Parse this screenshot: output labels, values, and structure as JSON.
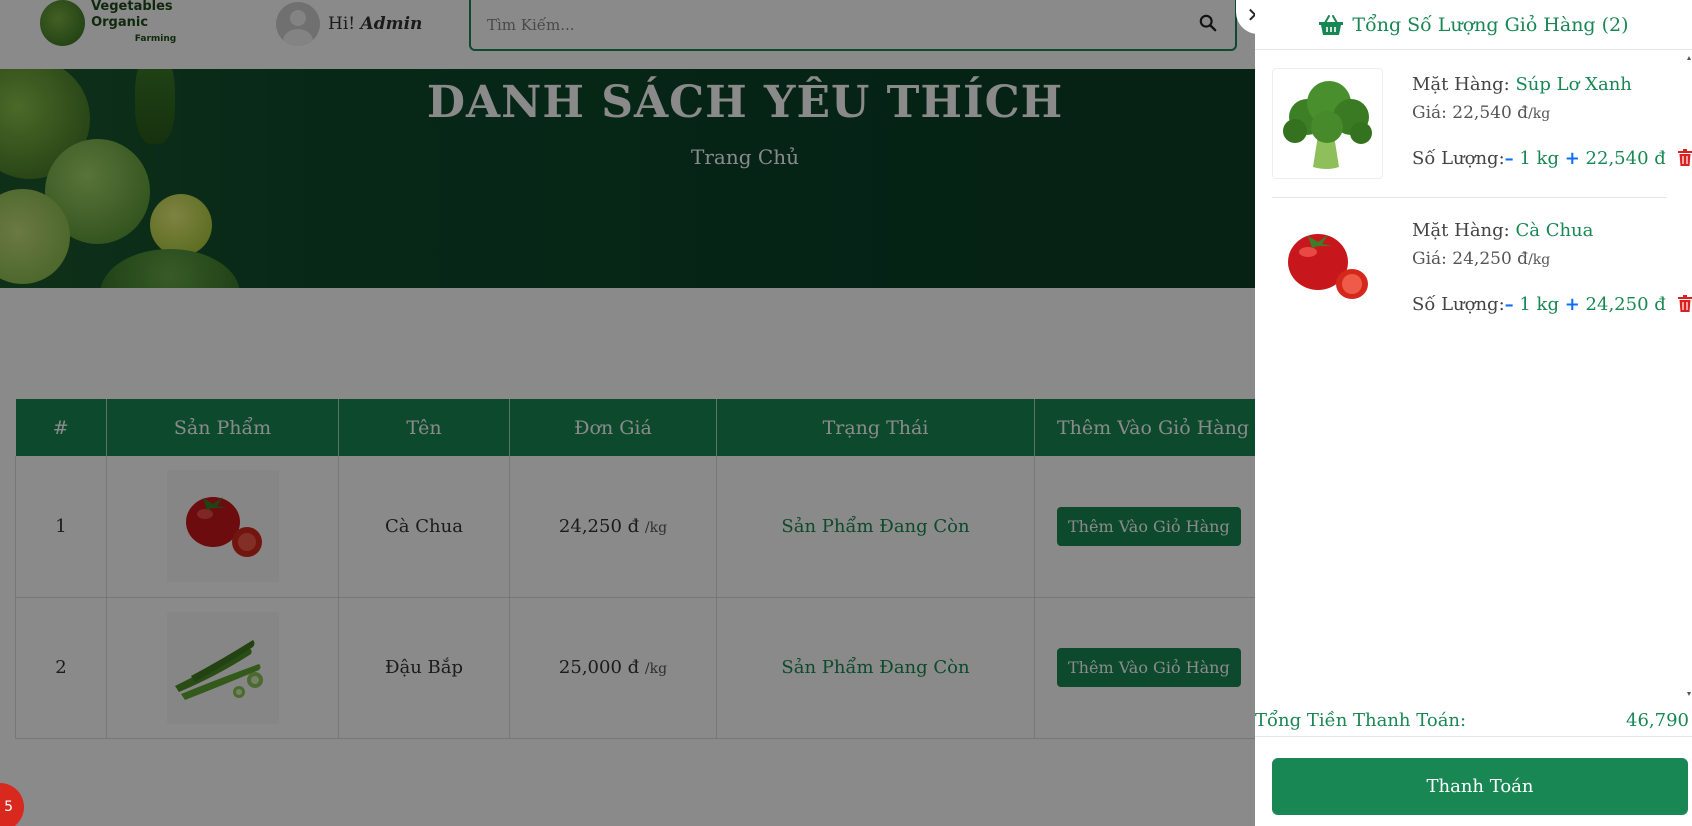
{
  "header": {
    "logo_title": "Vegetables Organic",
    "logo_sub": "Farming",
    "greeting": "Hi!",
    "user_name": "Admin",
    "search_placeholder": "Tìm Kiếm..."
  },
  "banner": {
    "title": "DANH SÁCH YÊU THÍCH",
    "breadcrumb": "Trang Chủ"
  },
  "table": {
    "headers": [
      "#",
      "Sản Phẩm",
      "Tên",
      "Đơn Giá",
      "Trạng Thái",
      "Thêm Vào Giỏ Hàng"
    ],
    "rows": [
      {
        "index": "1",
        "name": "Cà Chua",
        "price": "24,250 đ",
        "unit": "/kg",
        "status": "Sản Phẩm Đang Còn",
        "button": "Thêm Vào Giỏ Hàng",
        "image_icon": "tomato-image"
      },
      {
        "index": "2",
        "name": "Đậu Bắp",
        "price": "25,000 đ",
        "unit": "/kg",
        "status": "Sản Phẩm Đang Còn",
        "button": "Thêm Vào Giỏ Hàng",
        "image_icon": "okra-image"
      }
    ]
  },
  "badge": "5",
  "cart": {
    "title": "Tổng Số Lượng Giỏ Hàng (2)",
    "close": "✕",
    "items": [
      {
        "item_label": "Mặt Hàng:",
        "name": "Súp Lơ Xanh",
        "price_label": "Giá:",
        "price": "22,540 đ",
        "unit": "/kg",
        "qty_label": "Số Lượng:",
        "minus": "–",
        "qty": "1 kg",
        "plus": "+",
        "subtotal": "22,540 đ",
        "image_icon": "broccoli-image"
      },
      {
        "item_label": "Mặt Hàng:",
        "name": "Cà Chua",
        "price_label": "Giá:",
        "price": "24,250 đ",
        "unit": "/kg",
        "qty_label": "Số Lượng:",
        "minus": "–",
        "qty": "1 kg",
        "plus": "+",
        "subtotal": "24,250 đ",
        "image_icon": "tomato-image"
      }
    ],
    "total_label": "Tổng Tiền Thanh Toán:",
    "total_value": "46,790",
    "checkout": "Thanh Toán"
  },
  "colors": {
    "primary_green": "#198754",
    "banner_dark": "#0b4128",
    "badge_red": "#d9281e",
    "link_blue": "#0d6efd"
  }
}
